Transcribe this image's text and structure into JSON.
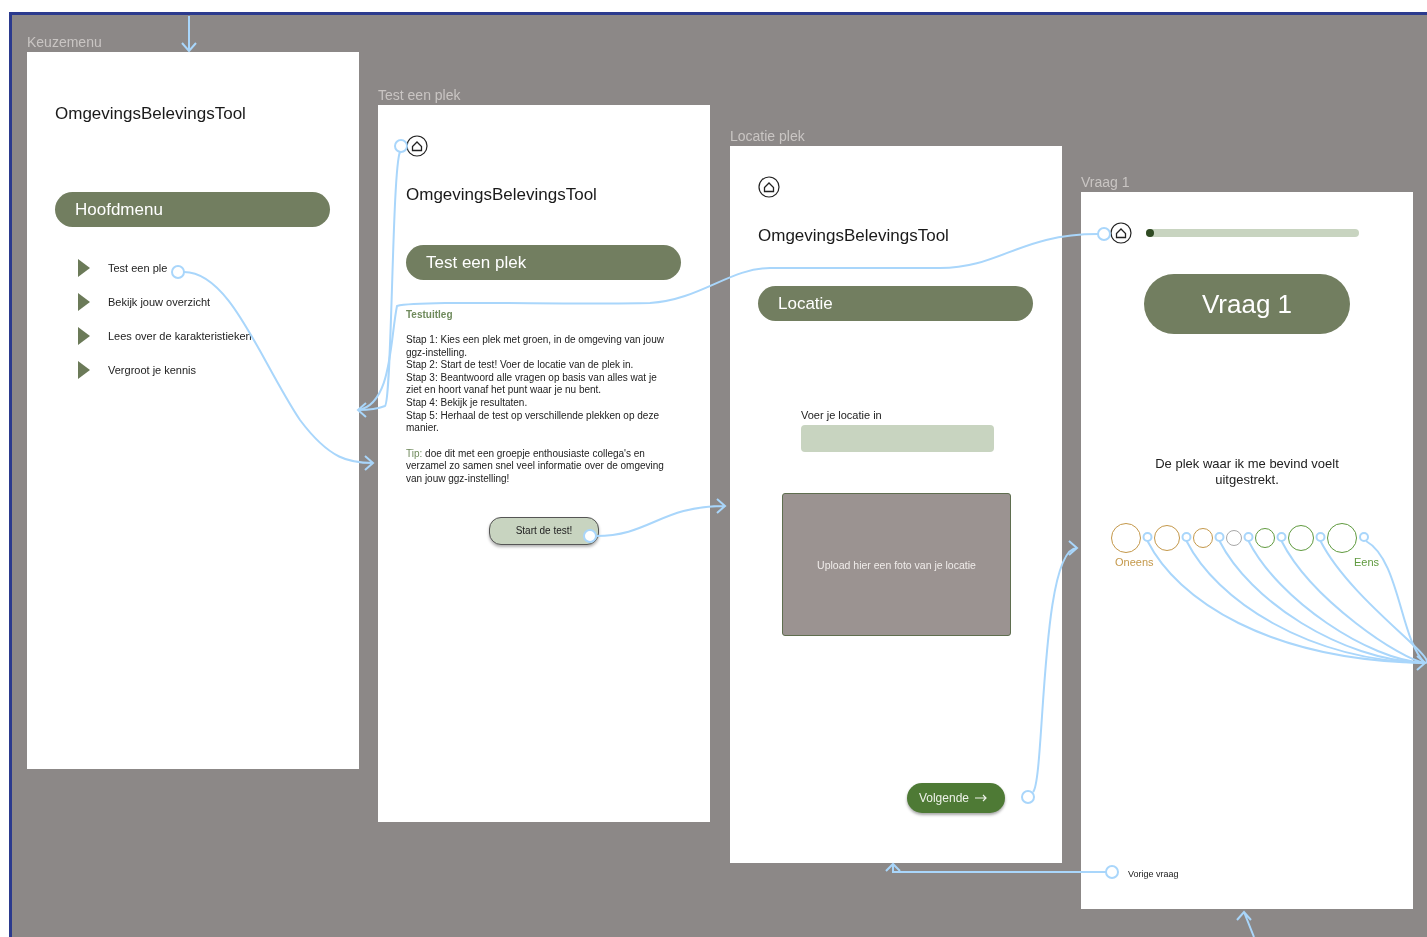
{
  "frames": [
    {
      "kind": "menu",
      "label": "Keuzemenu",
      "title": "OmgevingsBelevingsTool",
      "header": "Hoofdmenu",
      "items": [
        "Test een ple",
        "Bekijk jouw overzicht",
        "Lees over de karakteristieken",
        "Vergroot je kennis"
      ]
    },
    {
      "kind": "intro",
      "label": "Test een plek",
      "title": "OmgevingsBelevingsTool",
      "header": "Test een plek",
      "subheading": "Testuitleg",
      "steps": [
        "Stap 1: Kies een plek met groen, in de omgeving van jouw ggz-instelling.",
        "Stap 2: Start de test! Voer de locatie van de plek in.",
        "Stap 3: Beantwoord alle vragen op basis van alles wat je ziet en hoort vanaf het punt waar je nu bent.",
        "Stap 4: Bekijk je resultaten.",
        "Stap 5: Herhaal de test op verschillende plekken op deze manier."
      ],
      "tip": {
        "label": "Tip:",
        "text": "doe dit met een groepje enthousiaste collega's en verzamel zo samen snel veel informatie over de omgeving van jouw ggz-instelling!"
      },
      "button": "Start de test!"
    },
    {
      "kind": "location",
      "label": "Locatie plek",
      "title": "OmgevingsBelevingsTool",
      "header": "Locatie",
      "field_label": "Voer je locatie in",
      "upload": "Upload hier een foto van je locatie",
      "button": "Volgende"
    },
    {
      "kind": "question",
      "label": "Vraag 1",
      "progress": {
        "level": 0.0
      },
      "header": "Vraag 1",
      "question": "De plek waar ik me bevind voelt uitgestrekt.",
      "scale": [
        {
          "color": "#c4984a",
          "selected": false
        },
        {
          "color": "#c4984a",
          "selected": false
        },
        {
          "color": "#c4984a",
          "selected": false
        },
        {
          "color": "#a8a8a8",
          "selected": false
        },
        {
          "color": "#5f9a3e",
          "selected": false
        },
        {
          "color": "#5f9a3e",
          "selected": false
        },
        {
          "color": "#5f9a3e",
          "selected": false
        }
      ],
      "low_label": "Oneens",
      "high_label": "Eens",
      "back": "Vorige vraag"
    }
  ]
}
